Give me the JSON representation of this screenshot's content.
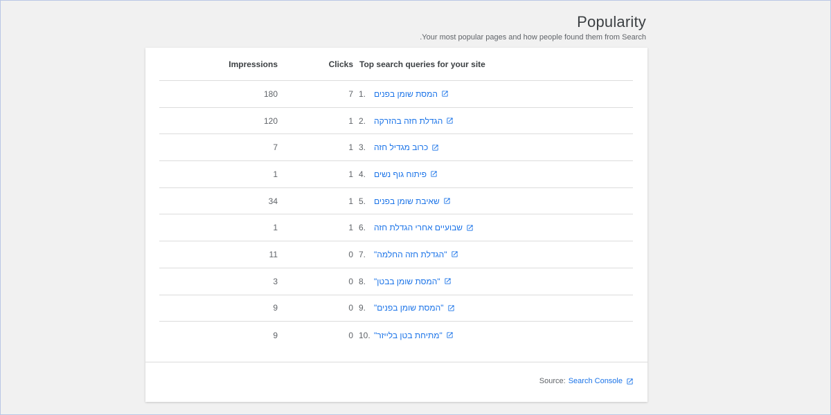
{
  "header": {
    "title": "Popularity",
    "subtitle": ".Your most popular pages and how people found them from Search"
  },
  "table": {
    "columns": {
      "impressions": "Impressions",
      "clicks": "Clicks",
      "query": "Top search queries for your site"
    },
    "rows": [
      {
        "rank": "1.",
        "query": "המסת שומן בפנים",
        "clicks": "7",
        "impressions": "180"
      },
      {
        "rank": "2.",
        "query": "הגדלת חזה בהזרקה",
        "clicks": "1",
        "impressions": "120"
      },
      {
        "rank": "3.",
        "query": "כרוב מגדיל חזה",
        "clicks": "1",
        "impressions": "7"
      },
      {
        "rank": "4.",
        "query": "פיתוח גוף נשים",
        "clicks": "1",
        "impressions": "1"
      },
      {
        "rank": "5.",
        "query": "שאיבת שומן בפנים",
        "clicks": "1",
        "impressions": "34"
      },
      {
        "rank": "6.",
        "query": "שבועיים אחרי הגדלת חזה",
        "clicks": "1",
        "impressions": "1"
      },
      {
        "rank": "7.",
        "query": "\"הגדלת חזה החלמה\"",
        "clicks": "0",
        "impressions": "11"
      },
      {
        "rank": "8.",
        "query": "\"המסת שומן בבטן\"",
        "clicks": "0",
        "impressions": "3"
      },
      {
        "rank": "9.",
        "query": "\"המסת שומן בפנים\"",
        "clicks": "0",
        "impressions": "9"
      },
      {
        "rank": "10.",
        "query": "\"מתיחת בטן בלייזר\"",
        "clicks": "0",
        "impressions": "9"
      }
    ]
  },
  "footer": {
    "source_label": "Source:",
    "source_link": "Search Console"
  },
  "icons": {
    "link": "open-in-new-icon"
  },
  "colors": {
    "link": "#1a73e8",
    "background": "#f1f1f1"
  }
}
